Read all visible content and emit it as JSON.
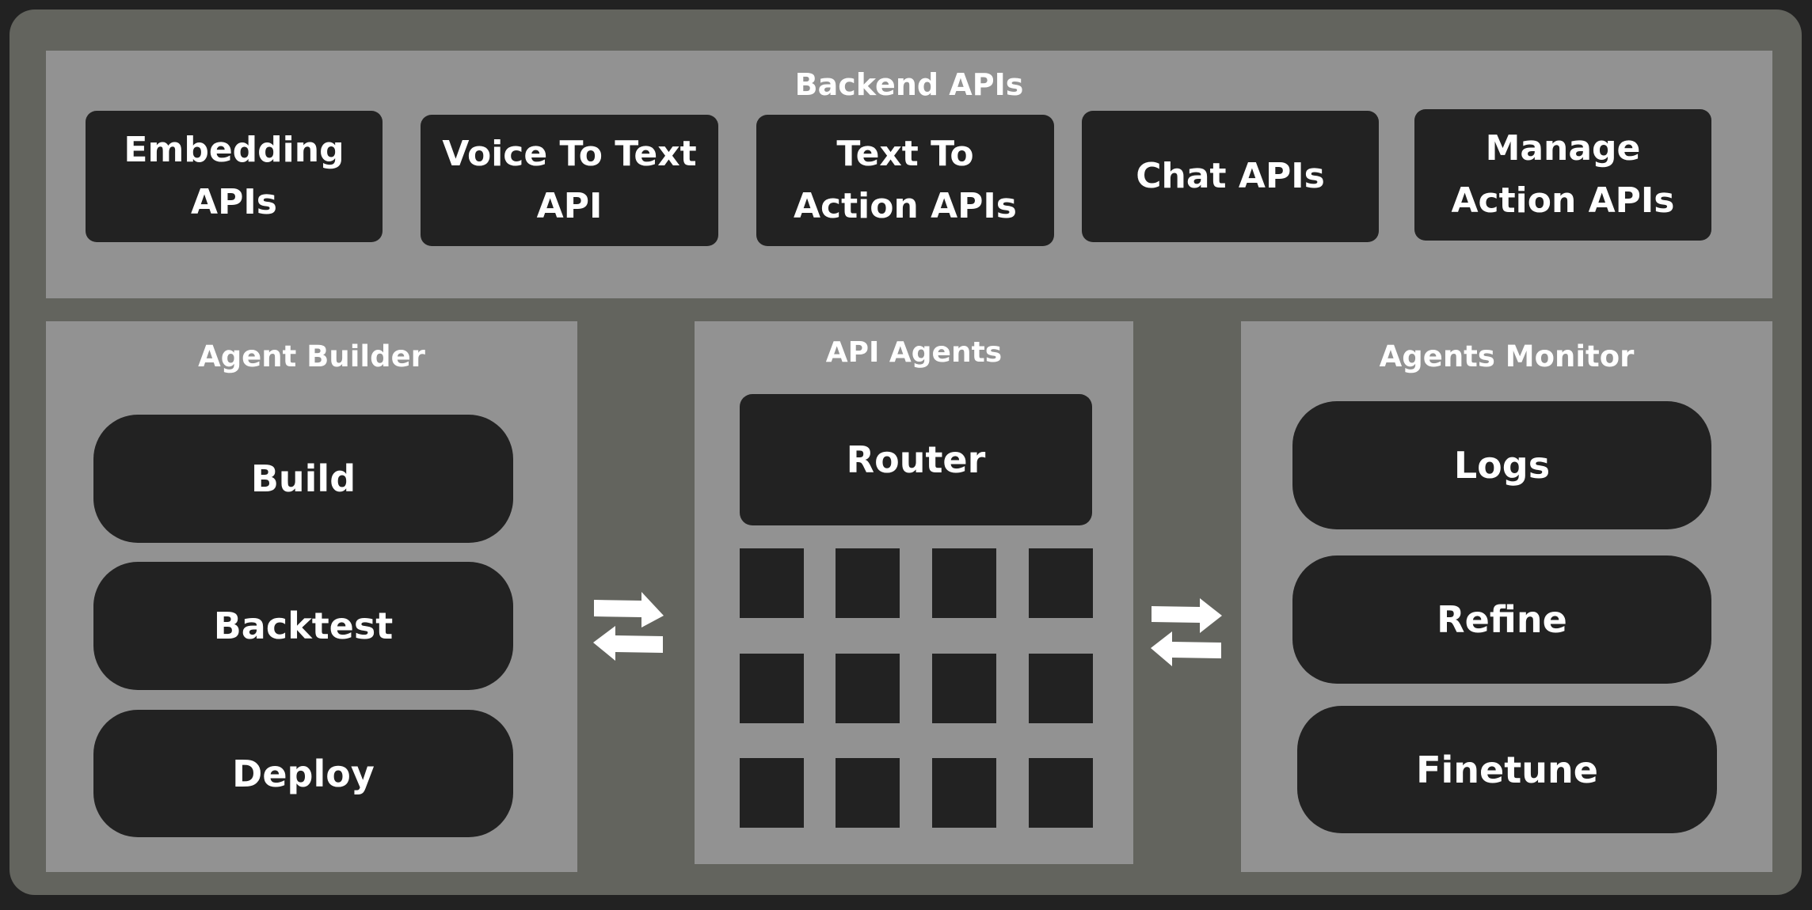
{
  "diagram": {
    "backend": {
      "title": "Backend APIs",
      "items": [
        {
          "label": "Embedding\nAPIs"
        },
        {
          "label": "Voice To Text\nAPI"
        },
        {
          "label": "Text To\nAction APIs"
        },
        {
          "label": "Chat APIs"
        },
        {
          "label": "Manage\nAction APIs"
        }
      ]
    },
    "agent_builder": {
      "title": "Agent Builder",
      "items": [
        {
          "label": "Build"
        },
        {
          "label": "Backtest"
        },
        {
          "label": "Deploy"
        }
      ]
    },
    "api_agents": {
      "title": "API Agents",
      "router_label": "Router",
      "agent_grid": {
        "rows": 3,
        "cols": 4
      }
    },
    "agents_monitor": {
      "title": "Agents Monitor",
      "items": [
        {
          "label": "Logs"
        },
        {
          "label": "Refine"
        },
        {
          "label": "Finetune"
        }
      ]
    },
    "connectors": [
      {
        "from": "Agent Builder",
        "to": "API Agents",
        "icon": "bidirectional-arrows-icon"
      },
      {
        "from": "API Agents",
        "to": "Agents Monitor",
        "icon": "bidirectional-arrows-icon"
      }
    ],
    "colors": {
      "background": "#222222",
      "frame": "#63645e",
      "panel": "#929292",
      "box": "#222222",
      "text": "#ffffff"
    }
  }
}
